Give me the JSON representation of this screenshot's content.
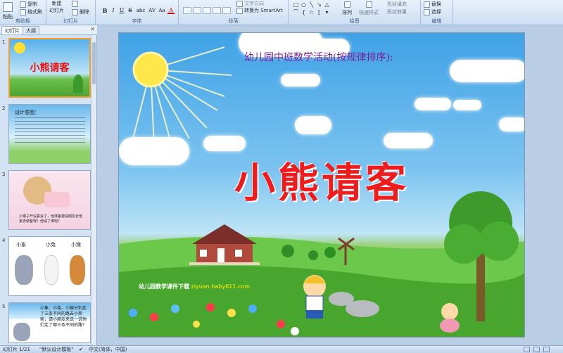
{
  "ribbon": {
    "clipboard": {
      "paste": "粘贴",
      "copy": "复制",
      "format_painter": "格式刷",
      "label": "剪贴板"
    },
    "slides": {
      "new_slide": "新建",
      "new_slide2": "幻灯片",
      "delete": "删除",
      "label": "幻灯片"
    },
    "font": {
      "label": "字体",
      "bold": "B",
      "italic": "I",
      "underline": "U",
      "strike": "S",
      "shadow": "abc",
      "spacing": "AV",
      "case": "Aa",
      "color": "A"
    },
    "paragraph": {
      "label": "段落",
      "text_dir": "文字方向",
      "smartart": "转换为 SmartArt"
    },
    "drawing": {
      "label": "绘图",
      "arrange": "排列",
      "quick_styles": "快速样式",
      "shape_fill": "形状填充",
      "shape_effects": "形状效果"
    },
    "editing": {
      "label": "编辑",
      "replace": "替换",
      "select": "选择"
    }
  },
  "panel": {
    "tabs": [
      "幻灯片",
      "大纲"
    ],
    "slides": [
      {
        "num": "1",
        "title": "小熊请客"
      },
      {
        "num": "2",
        "title": "设计意图："
      },
      {
        "num": "3",
        "caption": "小猴子开设宴会了，他准备邀请朋友去他家去做客呀！他请了谁呢？"
      },
      {
        "num": "4",
        "labels": [
          "小象",
          "小兔",
          "小猴"
        ]
      },
      {
        "num": "5",
        "text": "小象、小兔、小猴分别走了三条不同的路去小熊家，请小朋友来说一说他们走了哪三条不同的路？"
      }
    ]
  },
  "slide": {
    "subtitle": "幼儿园中班数学活动(按规律排序):",
    "title": "小熊请客",
    "watermark_a": "幼儿园教学课件下载",
    "watermark_b": "ziyuan.baby611.com"
  },
  "status": {
    "slide_count": "幻灯片 1/21",
    "theme": "\"默认设计模板\"",
    "language": "中文(简体，中国)"
  },
  "colors": {
    "title": "#ee1c1c",
    "subtitle": "#7a1f9a",
    "sky": "#3fa2e6",
    "grass": "#57b33a",
    "selection": "#f0a030"
  }
}
